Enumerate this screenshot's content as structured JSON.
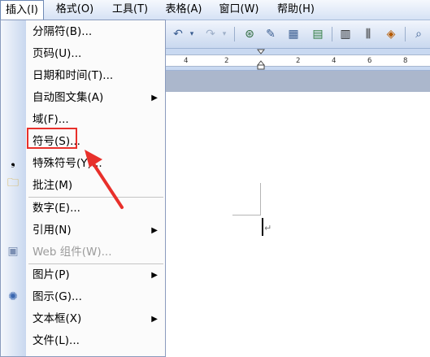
{
  "menubar": {
    "insert": "插入(I)",
    "format": "格式(O)",
    "tools": "工具(T)",
    "table": "表格(A)",
    "window": "窗口(W)",
    "help": "帮助(H)"
  },
  "ruler": {
    "ticks": [
      "4",
      "2",
      "2",
      "4",
      "6",
      "8"
    ]
  },
  "insert_menu": {
    "items": [
      {
        "label": "分隔符(B)...",
        "enabled": true,
        "submenu": false
      },
      {
        "label": "页码(U)...",
        "enabled": true,
        "submenu": false
      },
      {
        "label": "日期和时间(T)...",
        "enabled": true,
        "submenu": false
      },
      {
        "label": "自动图文集(A)",
        "enabled": true,
        "submenu": true
      },
      {
        "label": "域(F)...",
        "enabled": true,
        "submenu": false
      },
      {
        "label": "符号(S)...",
        "enabled": true,
        "submenu": false,
        "highlighted": true
      },
      {
        "label": "特殊符号(Y)...",
        "enabled": true,
        "submenu": false
      },
      {
        "label": "批注(M)",
        "enabled": true,
        "submenu": false
      },
      {
        "label": "数字(E)...",
        "enabled": true,
        "submenu": false
      },
      {
        "label": "引用(N)",
        "enabled": true,
        "submenu": true
      },
      {
        "label": "Web 组件(W)...",
        "enabled": false,
        "submenu": false
      },
      {
        "label": "图片(P)",
        "enabled": true,
        "submenu": true
      },
      {
        "label": "图示(G)...",
        "enabled": true,
        "submenu": false
      },
      {
        "label": "文本框(X)",
        "enabled": true,
        "submenu": true
      },
      {
        "label": "文件(L)...",
        "enabled": true,
        "submenu": false
      }
    ]
  },
  "icons": {
    "undo": "undo-icon",
    "redo": "redo-icon",
    "hyperlink": "hyperlink-icon",
    "tables_borders": "tables-borders-icon",
    "insert_table": "insert-table-icon",
    "insert_excel": "insert-excel-icon",
    "columns": "columns-icon",
    "drawing": "drawing-icon",
    "document_map": "document-map-icon",
    "read": "read-icon"
  },
  "colors": {
    "annotation": "#e8302b",
    "menu_border": "#8a9bbd",
    "toolbar_top": "#f1f5fc",
    "toolbar_bottom": "#c9d8ef"
  }
}
